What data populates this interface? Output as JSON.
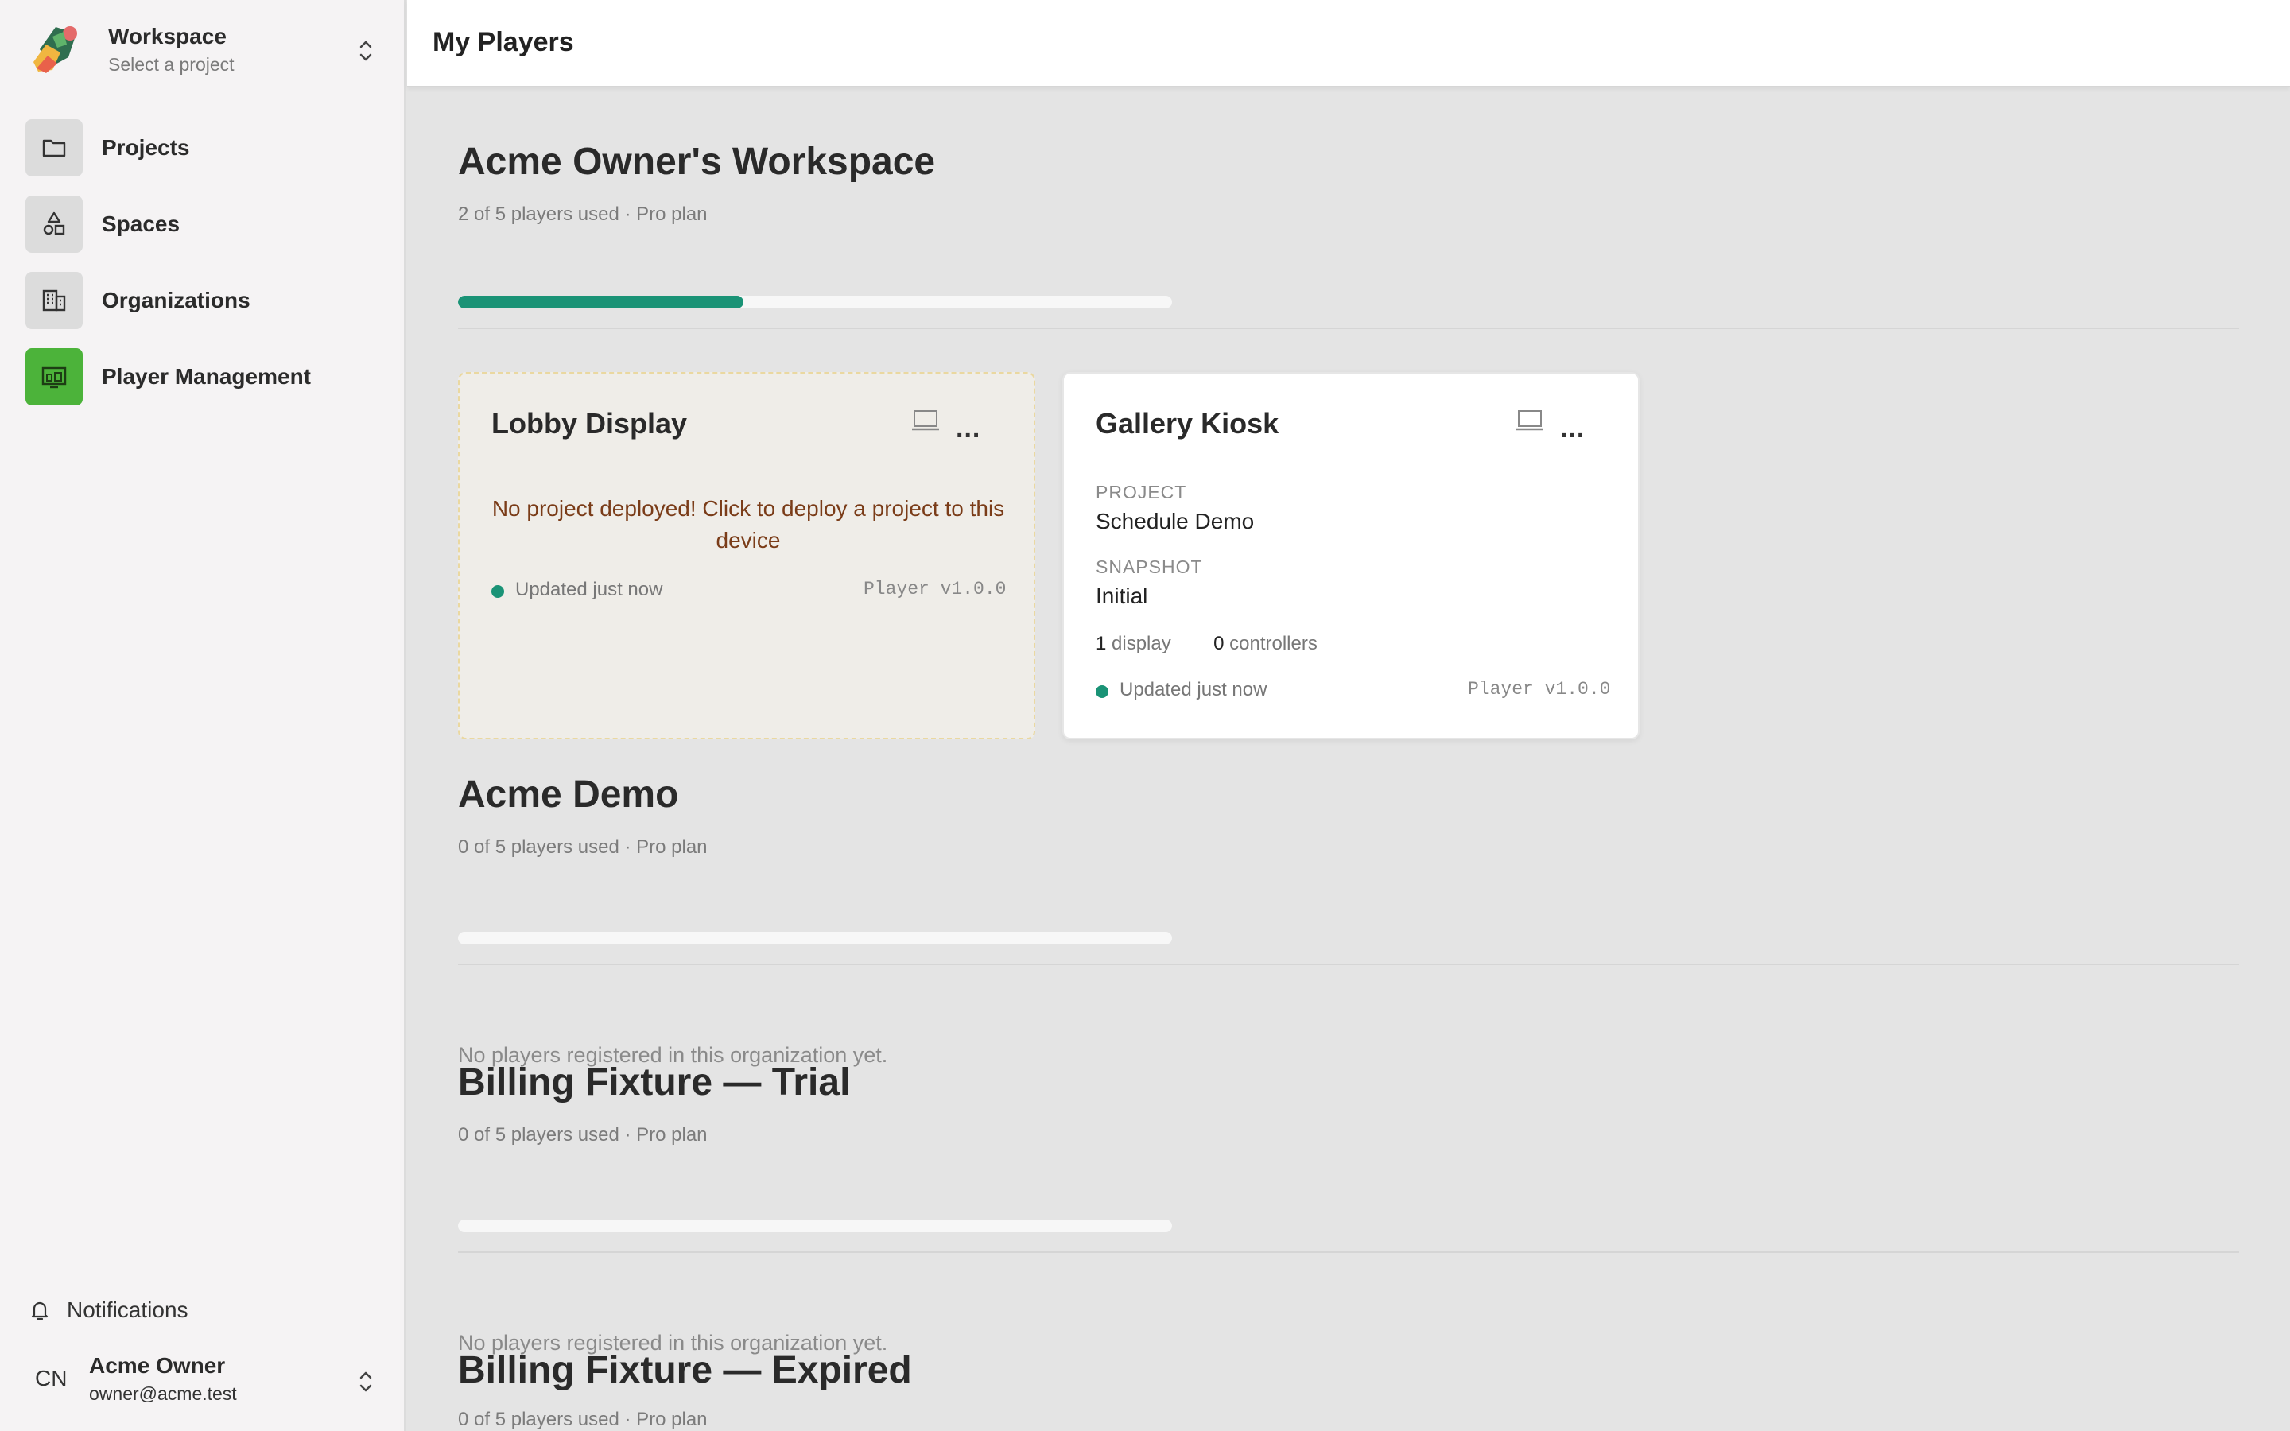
{
  "workspace_switcher": {
    "title": "Workspace",
    "subtitle": "Select a project"
  },
  "nav": [
    {
      "label": "Projects",
      "icon": "folder-icon",
      "active": false
    },
    {
      "label": "Spaces",
      "icon": "shapes-icon",
      "active": false
    },
    {
      "label": "Organizations",
      "icon": "building-icon",
      "active": false
    },
    {
      "label": "Player Management",
      "icon": "display-icon",
      "active": true
    }
  ],
  "notifications": {
    "label": "Notifications"
  },
  "user": {
    "initials": "CN",
    "name": "Acme Owner",
    "email": "owner@acme.test"
  },
  "header": {
    "title": "My Players"
  },
  "organizations": [
    {
      "name": "Acme Owner's Workspace",
      "usage_text": "2 of 5 players used · Pro plan",
      "players_used": 2,
      "players_total": 5,
      "players": [
        {
          "name": "Lobby Display",
          "deployed": false,
          "warning": "No project deployed! Click to deploy a project to this device",
          "status": "Updated just now",
          "version": "Player v1.0.0"
        },
        {
          "name": "Gallery Kiosk",
          "deployed": true,
          "project_label": "PROJECT",
          "project": "Schedule Demo",
          "snapshot_label": "SNAPSHOT",
          "snapshot": "Initial",
          "display_count": "1",
          "display_label": "display",
          "controller_count": "0",
          "controller_label": "controllers",
          "status": "Updated just now",
          "version": "Player v1.0.0"
        }
      ]
    },
    {
      "name": "Acme Demo",
      "usage_text": "0 of 5 players used · Pro plan",
      "players_used": 0,
      "players_total": 5,
      "empty_text": "No players registered in this organization yet."
    },
    {
      "name": "Billing Fixture — Trial",
      "usage_text": "0 of 5 players used · Pro plan",
      "players_used": 0,
      "players_total": 5,
      "empty_text": "No players registered in this organization yet."
    },
    {
      "name": "Billing Fixture — Expired",
      "usage_text": "0 of 5 players used · Pro plan",
      "players_used": 0,
      "players_total": 5
    }
  ],
  "colors": {
    "accent": "#1a9376",
    "active_nav": "#4cb33a",
    "warning_text": "#7a3c18",
    "warning_border": "#ead8a0"
  }
}
